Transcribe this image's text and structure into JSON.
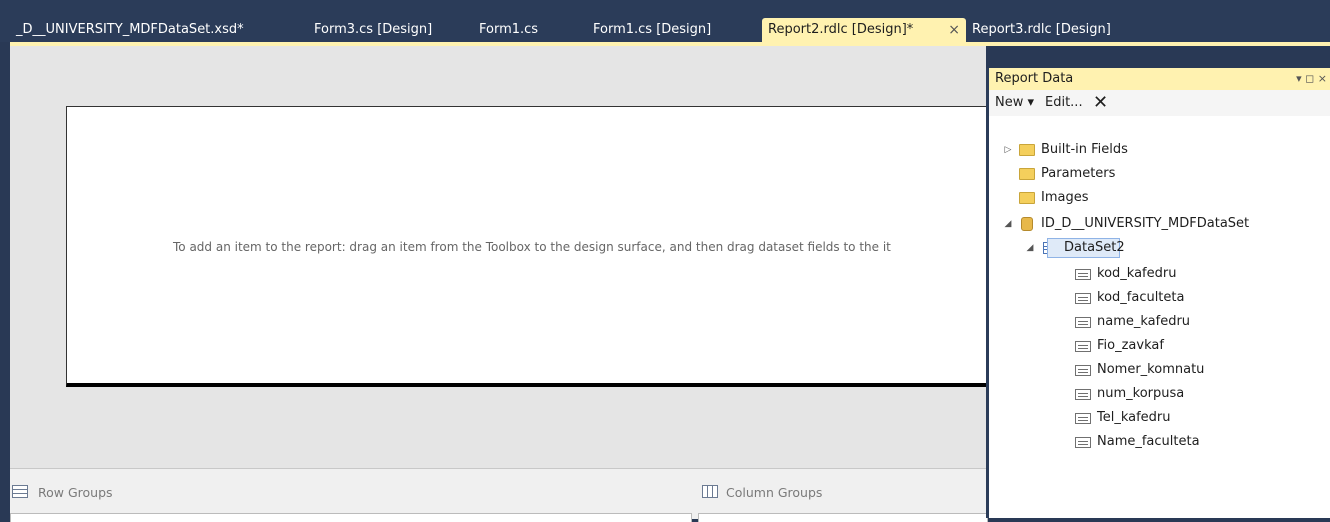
{
  "tabs": [
    {
      "label": "_D__UNIVERSITY_MDFDataSet.xsd*"
    },
    {
      "label": "Form3.cs [Design]"
    },
    {
      "label": "Form1.cs"
    },
    {
      "label": "Form1.cs [Design]"
    },
    {
      "label": "Report2.rdlc [Design]*",
      "active": true
    },
    {
      "label": "Report3.rdlc [Design]"
    }
  ],
  "tab_close_icon": "×",
  "design": {
    "hint": "To add an item to the report: drag an item from the Toolbox to the design surface, and then drag dataset fields to the it"
  },
  "groups": {
    "row_label": "Row Groups",
    "column_label": "Column Groups"
  },
  "report_data": {
    "title": "Report Data",
    "controls": "▾ ◻ ×",
    "toolbar": {
      "new_label": "New ▾",
      "edit_label": "Edit...",
      "delete_icon": "✕"
    },
    "tree": {
      "builtin": "Built-in Fields",
      "parameters": "Parameters",
      "images": "Images",
      "dataset_source": "ID_D__UNIVERSITY_MDFDataSet",
      "dataset": "DataSet2",
      "fields": [
        "kod_kafedru",
        "kod_faculteta",
        "name_kafedru",
        "Fio_zavkaf",
        "Nomer_komnatu",
        "num_korpusa",
        "Tel_kafedru",
        "Name_faculteta"
      ]
    }
  },
  "colors": {
    "chrome": "#2b3c59",
    "active_tab": "#fff2b0",
    "canvas": "#e5e5e5"
  }
}
